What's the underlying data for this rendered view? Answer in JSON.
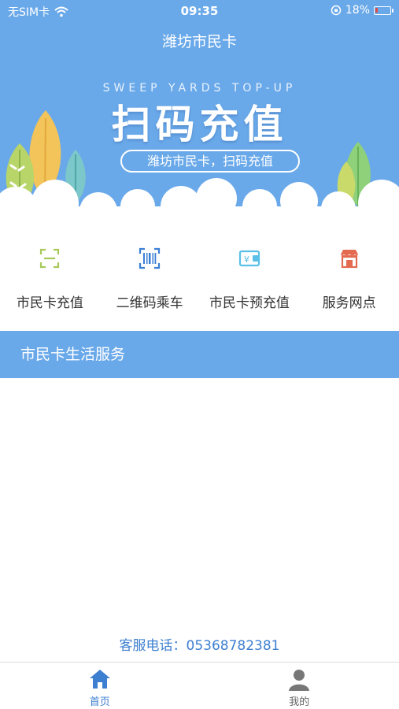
{
  "status_bar": {
    "carrier": "无SIM卡",
    "time": "09:35",
    "battery": "18%",
    "battery_level": 0.18
  },
  "header": {
    "title": "潍坊市民卡"
  },
  "banner": {
    "subtitle_en": "SWEEP YARDS TOP-UP",
    "title": "扫码充值",
    "pill_text": "潍坊市民卡，扫码充值"
  },
  "quick_menu": {
    "items": [
      {
        "label": "市民卡充值",
        "icon": "scan-frame-icon"
      },
      {
        "label": "二维码乘车",
        "icon": "barcode-icon"
      },
      {
        "label": "市民卡预充值",
        "icon": "wallet-icon"
      },
      {
        "label": "服务网点",
        "icon": "store-icon"
      }
    ]
  },
  "section": {
    "title": "市民卡生活服务"
  },
  "footer": {
    "service_phone": "客服电话：05368782381"
  },
  "tab_bar": {
    "tabs": [
      {
        "label": "首页",
        "icon": "home-icon",
        "active": true
      },
      {
        "label": "我的",
        "icon": "user-icon",
        "active": false
      }
    ]
  },
  "colors": {
    "primary": "#6aa9e9",
    "link": "#3d7fd0",
    "icon_green": "#a8c85a",
    "icon_blue": "#3b7fd4",
    "icon_cyan": "#5bc0e8",
    "icon_red": "#e46a4f"
  }
}
